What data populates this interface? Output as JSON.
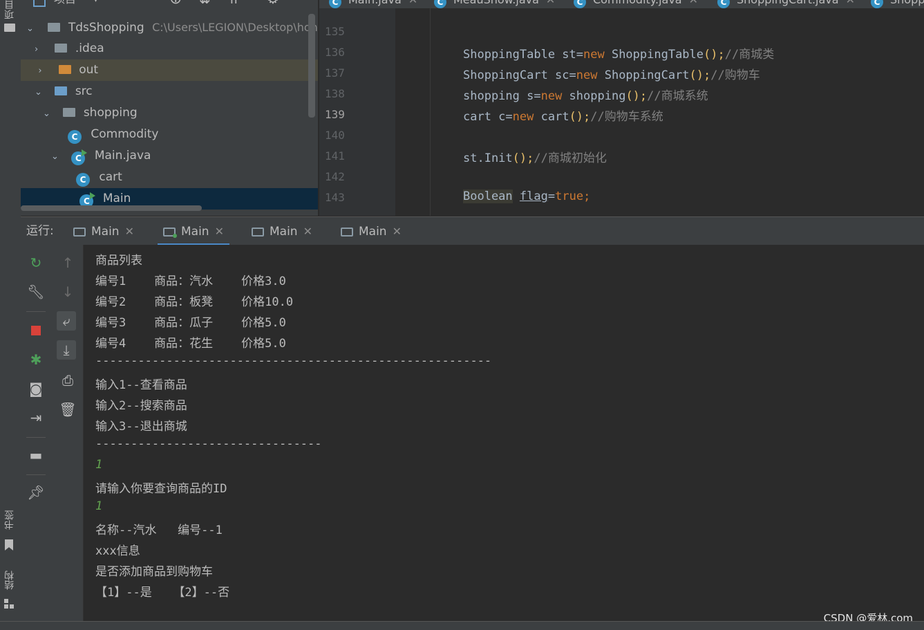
{
  "left_strip": {
    "project_label": "项目",
    "bookmarks_label": "书签",
    "structure_label": "结构"
  },
  "project_panel": {
    "header_title": "项目",
    "tree": [
      {
        "label": "TdsShopping",
        "path": "C:\\Users\\LEGION\\Desktop\\hon",
        "kind": "module"
      },
      {
        "label": ".idea",
        "kind": "folder"
      },
      {
        "label": "out",
        "kind": "folder-orange"
      },
      {
        "label": "src",
        "kind": "folder-blue"
      },
      {
        "label": "shopping",
        "kind": "package"
      },
      {
        "label": "Commodity",
        "kind": "class"
      },
      {
        "label": "Main.java",
        "kind": "class-run"
      },
      {
        "label": "cart",
        "kind": "class"
      },
      {
        "label": "Main",
        "kind": "class-run"
      }
    ]
  },
  "editor": {
    "tabs": [
      {
        "label": "Main.java"
      },
      {
        "label": "MeauShow.java"
      },
      {
        "label": "Commodity.java"
      },
      {
        "label": "ShoppingCart.java"
      },
      {
        "label": "Shopp"
      }
    ],
    "line_numbers": [
      "135",
      "136",
      "137",
      "138",
      "139",
      "140",
      "141",
      "142",
      "143"
    ],
    "current_line": "139",
    "code": {
      "l136": {
        "a": "ShoppingTable st=",
        "kw": "new",
        "b": " ShoppingTable",
        "p": "();",
        "c": "//商城类"
      },
      "l137": {
        "a": "ShoppingCart sc=",
        "kw": "new",
        "b": " ShoppingCart",
        "p": "();",
        "c": "//购物车"
      },
      "l138": {
        "a": "shopping s=",
        "kw": "new",
        "b": " shopping",
        "p": "();",
        "c": "//商城系统"
      },
      "l139": {
        "a": "cart c=",
        "kw": "new",
        "b": " cart",
        "p": "();",
        "c": "//购物车系统"
      },
      "l141": {
        "a": "st.Init",
        "p": "();",
        "c": "//商城初始化"
      },
      "l143": {
        "a": "Boolean",
        "sp": " ",
        "b": "flag",
        "eq": "=",
        "kw": "true",
        "p": ";"
      }
    }
  },
  "run": {
    "label": "运行:",
    "tabs": [
      {
        "label": "Main"
      },
      {
        "label": "Main"
      },
      {
        "label": "Main"
      },
      {
        "label": "Main"
      }
    ],
    "active_tab_index": 1,
    "console_lines": [
      {
        "text": "商品列表",
        "input": false
      },
      {
        "text": "编号1    商品：汽水    价格3.0",
        "input": false
      },
      {
        "text": "编号2    商品：板凳    价格10.0",
        "input": false
      },
      {
        "text": "编号3    商品：瓜子    价格5.0",
        "input": false
      },
      {
        "text": "编号4    商品：花生    价格5.0",
        "input": false
      },
      {
        "text": "--------------------------------------------------------",
        "input": false
      },
      {
        "text": "输入1--查看商品",
        "input": false
      },
      {
        "text": "输入2--搜索商品",
        "input": false
      },
      {
        "text": "输入3--退出商城",
        "input": false
      },
      {
        "text": "--------------------------------",
        "input": false
      },
      {
        "text": "1",
        "input": true
      },
      {
        "text": "请输入你要查询商品的ID",
        "input": false
      },
      {
        "text": "1",
        "input": true
      },
      {
        "text": "名称--汽水   编号--1",
        "input": false
      },
      {
        "text": "xxx信息",
        "input": false
      },
      {
        "text": "是否添加商品到购物车",
        "input": false
      },
      {
        "text": "【1】--是   【2】--否",
        "input": false
      }
    ]
  },
  "watermark": "CSDN @爱林.com",
  "colors": {
    "accent": "#4a88c7",
    "keyword": "#cc7832",
    "comment": "#808080",
    "input_text": "#62a24f"
  }
}
